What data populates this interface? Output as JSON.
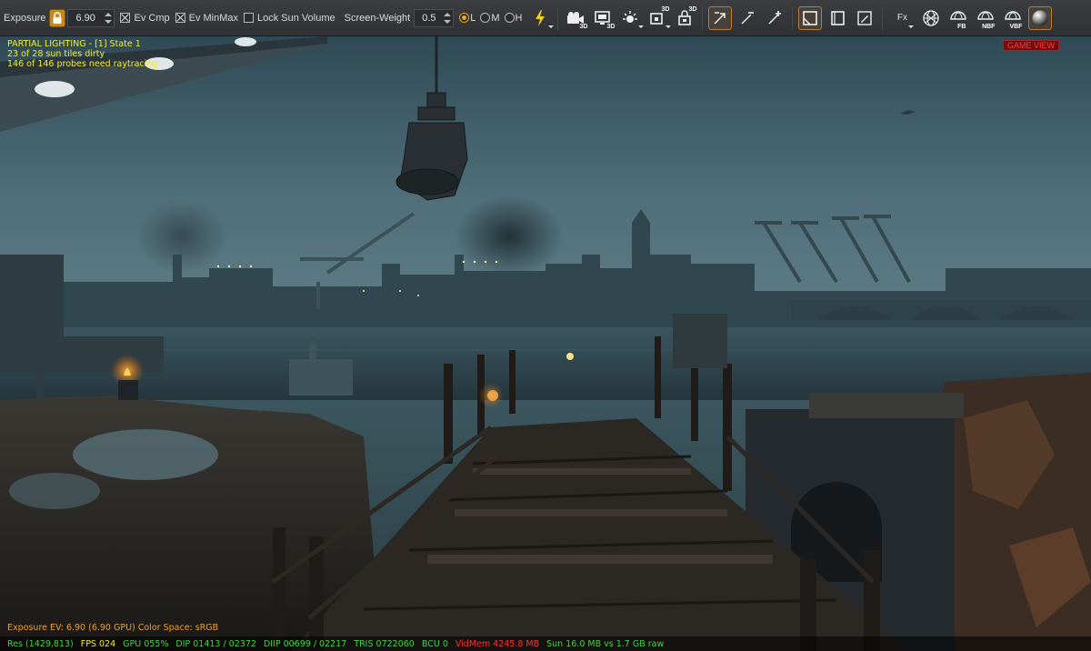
{
  "toolbar": {
    "exposure_label": "Exposure",
    "exposure_value": "6.90",
    "ev_cmp_label": "Ev Cmp",
    "ev_cmp_checked": true,
    "ev_minmax_label": "Ev MinMax",
    "ev_minmax_checked": true,
    "lock_sun_label": "Lock Sun Volume",
    "lock_sun_checked": false,
    "screen_weight_label": "Screen-Weight",
    "screen_weight_value": "0.5",
    "quality_options": [
      "L",
      "M",
      "H"
    ],
    "quality_selected": "L",
    "sub_3d": "3D",
    "sub_fb": "FB",
    "sub_nbf": "NBF",
    "sub_vbf": "VBF",
    "fx_label": "Fx",
    "accent_color": "#c07a28",
    "lock_color": "#c58a18"
  },
  "viewport": {
    "debug_lines": [
      "PARTIAL LIGHTING - [1] State 1",
      "23 of 28 sun tiles dirty",
      "146 of 146 probes need raytracing"
    ],
    "game_view_label": "GAME VIEW",
    "exposure_info": "Exposure EV: 6.90 (6.90 GPU)   Color Space: sRGB"
  },
  "statusbar": {
    "res": "Res (1429,813)",
    "fps": "FPS 024",
    "gpu": "GPU 055%",
    "dip": "DIP 01413 / 02372",
    "diip": "DIIP 00699 / 02217",
    "tris": "TRIS 0722060",
    "bcu": "BCU 0",
    "vidmem": "VidMem 4245.8 MB",
    "sun": "Sun 16.0 MB vs 1.7 GB raw"
  }
}
